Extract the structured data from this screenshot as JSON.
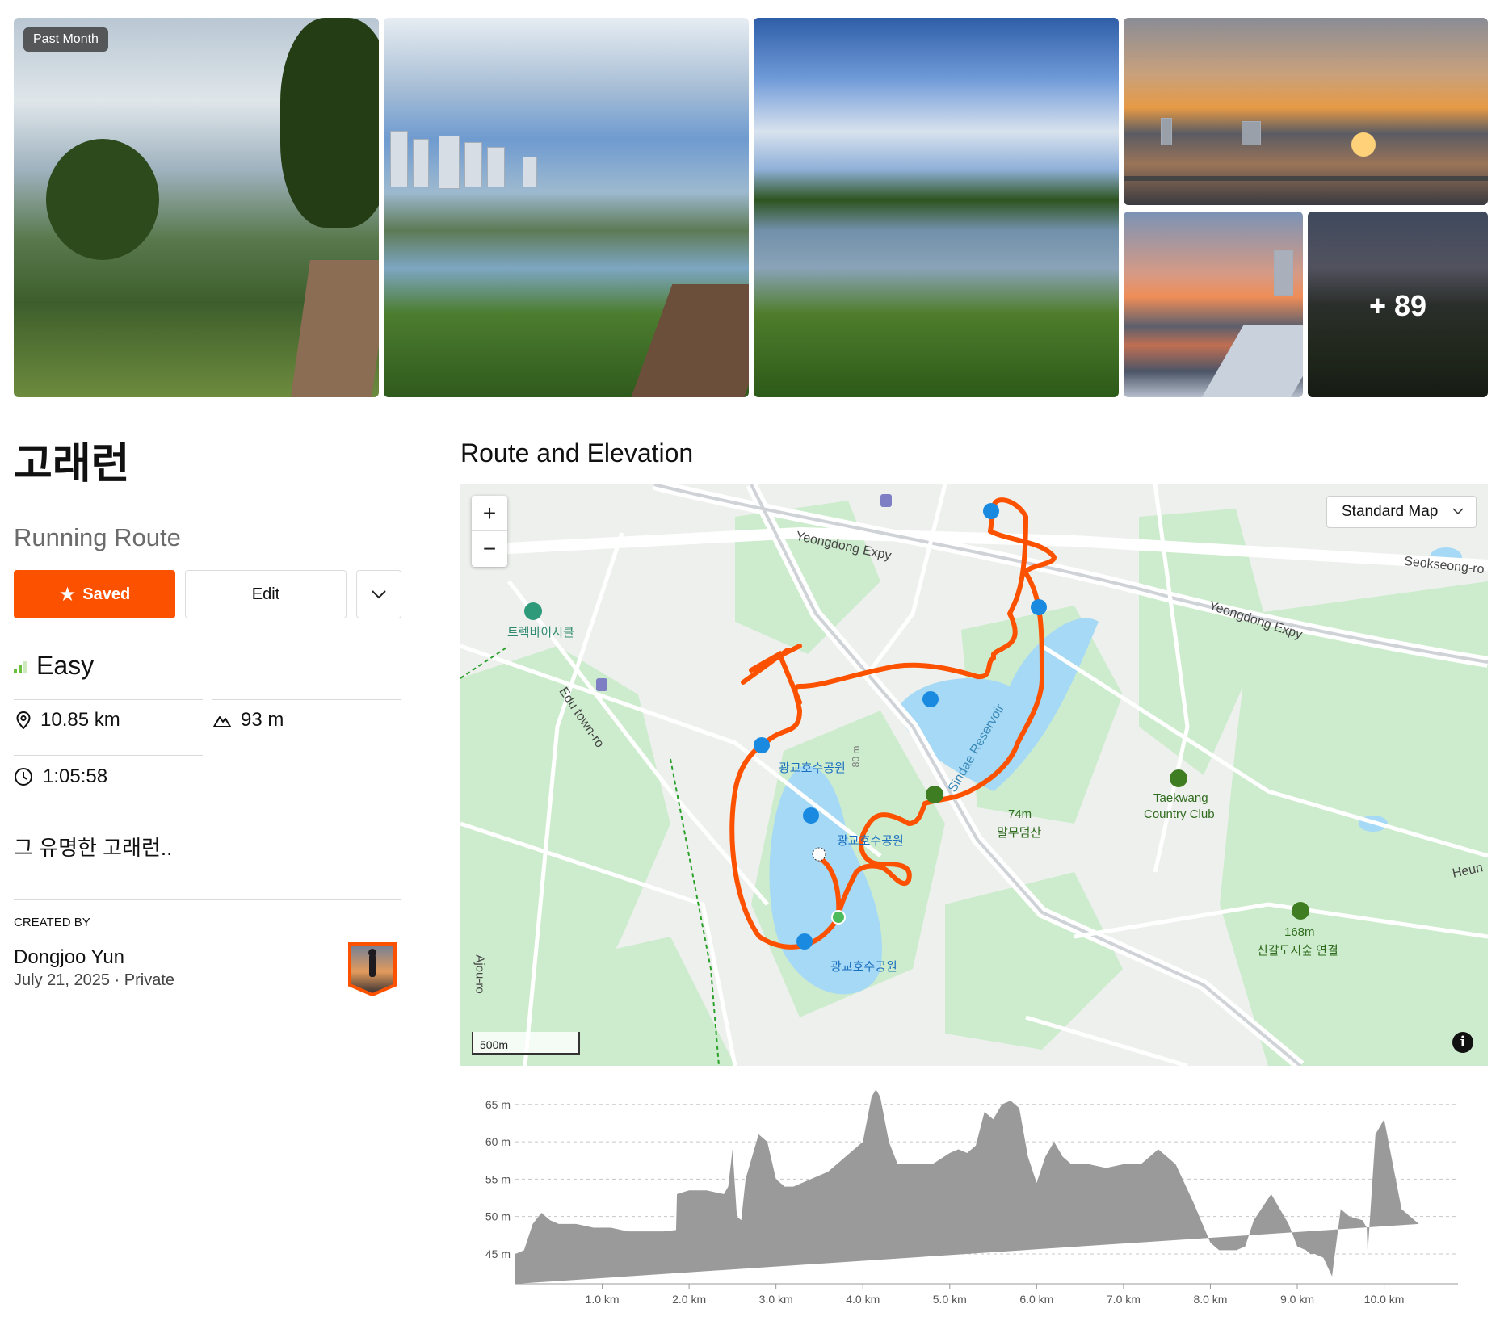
{
  "gallery": {
    "badge": "Past Month",
    "more_count": "+ 89"
  },
  "route": {
    "title": "고래런",
    "type": "Running Route",
    "saved_label": "Saved",
    "edit_label": "Edit",
    "difficulty": "Easy",
    "distance": "10.85 km",
    "elevation_gain": "93 m",
    "duration": "1:05:58",
    "description": "그 유명한 고래런..",
    "created_by_label": "CREATED BY",
    "creator_name": "Dongjoo Yun",
    "created_date": "July 21, 2025",
    "privacy": "Private"
  },
  "colors": {
    "brand": "#fc5200",
    "difficulty_green": "#6bbf3d",
    "route_line": "#fc5200",
    "elevation_fill": "#9a9a9a"
  },
  "section": {
    "title": "Route and Elevation"
  },
  "map": {
    "style_select": "Standard Map",
    "scale": "500m",
    "zoom_in": "+",
    "zoom_out": "−",
    "labels": {
      "road1": "Yeongdong Expy",
      "road2": "Yeongdong Expy",
      "road3": "Seokseong-ro",
      "road4": "Edu town-ro",
      "road5": "Ajou-ro",
      "road6": "Heun",
      "reservoir": "Sindae Reservoir",
      "shop": "트렉바이시클",
      "park1": "광교호수공원",
      "park2": "광교호수공원",
      "park3": "광교호수공원",
      "peak1_height": "74m",
      "peak1_name": "말무덤산",
      "golf": "Taekwang",
      "golf2": "Country Club",
      "peak2_height": "168m",
      "peak2_name": "신갈도시숲 연결",
      "contour": "80 m"
    }
  },
  "chart_data": {
    "type": "area",
    "title": "",
    "xlabel": "",
    "ylabel": "",
    "x_unit": "km",
    "y_unit": "m",
    "xlim": [
      0,
      10.85
    ],
    "ylim": [
      41,
      68
    ],
    "x_ticks": [
      "1.0 km",
      "2.0 km",
      "3.0 km",
      "4.0 km",
      "5.0 km",
      "6.0 km",
      "7.0 km",
      "8.0 km",
      "9.0 km",
      "10.0 km"
    ],
    "y_ticks": [
      "45 m",
      "50 m",
      "55 m",
      "60 m",
      "65 m"
    ],
    "x": [
      0,
      0.1,
      0.2,
      0.3,
      0.4,
      0.5,
      0.7,
      0.9,
      1.1,
      1.3,
      1.5,
      1.7,
      1.85,
      1.86,
      2.0,
      2.2,
      2.4,
      2.45,
      2.5,
      2.55,
      2.6,
      2.65,
      2.7,
      2.8,
      2.9,
      3.0,
      3.1,
      3.2,
      3.4,
      3.6,
      3.8,
      3.9,
      4.0,
      4.1,
      4.15,
      4.2,
      4.3,
      4.4,
      4.5,
      4.6,
      4.8,
      5.0,
      5.1,
      5.2,
      5.3,
      5.4,
      5.5,
      5.6,
      5.7,
      5.8,
      5.9,
      6.0,
      6.1,
      6.2,
      6.25,
      6.3,
      6.4,
      6.5,
      6.6,
      6.8,
      7.0,
      7.2,
      7.4,
      7.6,
      7.8,
      8.0,
      8.1,
      8.3,
      8.4,
      8.5,
      8.7,
      8.9,
      9.0,
      9.1,
      9.15,
      9.2,
      9.3,
      9.4,
      9.5,
      9.6,
      9.75,
      9.8,
      9.81,
      9.9,
      10.0,
      10.1,
      10.2,
      10.3,
      10.4,
      10.5,
      10.55,
      10.6,
      10.7,
      10.8,
      10.85
    ],
    "values": [
      45,
      45.5,
      49,
      50.5,
      49.5,
      49,
      49,
      48.5,
      48.5,
      48,
      48,
      48,
      48.2,
      53,
      53.5,
      53.5,
      53,
      54,
      59,
      50,
      49.5,
      55,
      57,
      61,
      60,
      55,
      54,
      54,
      55,
      56,
      58,
      59,
      60,
      66,
      67,
      66,
      60,
      57,
      57,
      57,
      57,
      58.5,
      59,
      58.5,
      59.5,
      64,
      63,
      65,
      65.5,
      64.5,
      58,
      54.5,
      58,
      60,
      59,
      58,
      57,
      57,
      57,
      56.5,
      57,
      57,
      59,
      57,
      52,
      46.5,
      45.5,
      45.5,
      46,
      49.5,
      53,
      49,
      46,
      45.5,
      45,
      45,
      44.5,
      42,
      51,
      50,
      49.5,
      48.5,
      45,
      61,
      63,
      57,
      51,
      50,
      49
    ]
  }
}
